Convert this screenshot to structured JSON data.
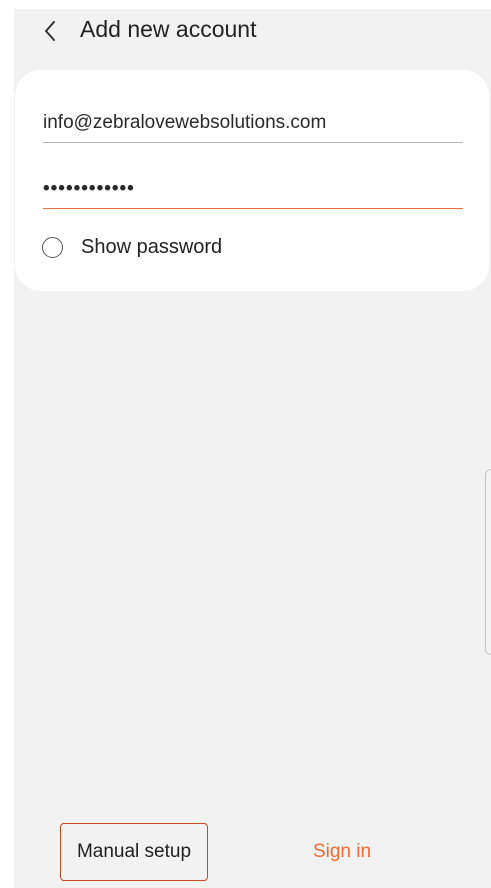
{
  "header": {
    "title": "Add new account",
    "back_icon": "chevron-left-icon"
  },
  "form": {
    "email_value": "info@zebralovewebsolutions.com",
    "password_masked": "••••••••••••",
    "show_password_label": "Show password",
    "show_password_checked": false
  },
  "footer": {
    "manual_setup_label": "Manual setup",
    "sign_in_label": "Sign in"
  },
  "colors": {
    "accent": "#ef6b31",
    "background": "#f2f2f2",
    "card": "#ffffff"
  }
}
